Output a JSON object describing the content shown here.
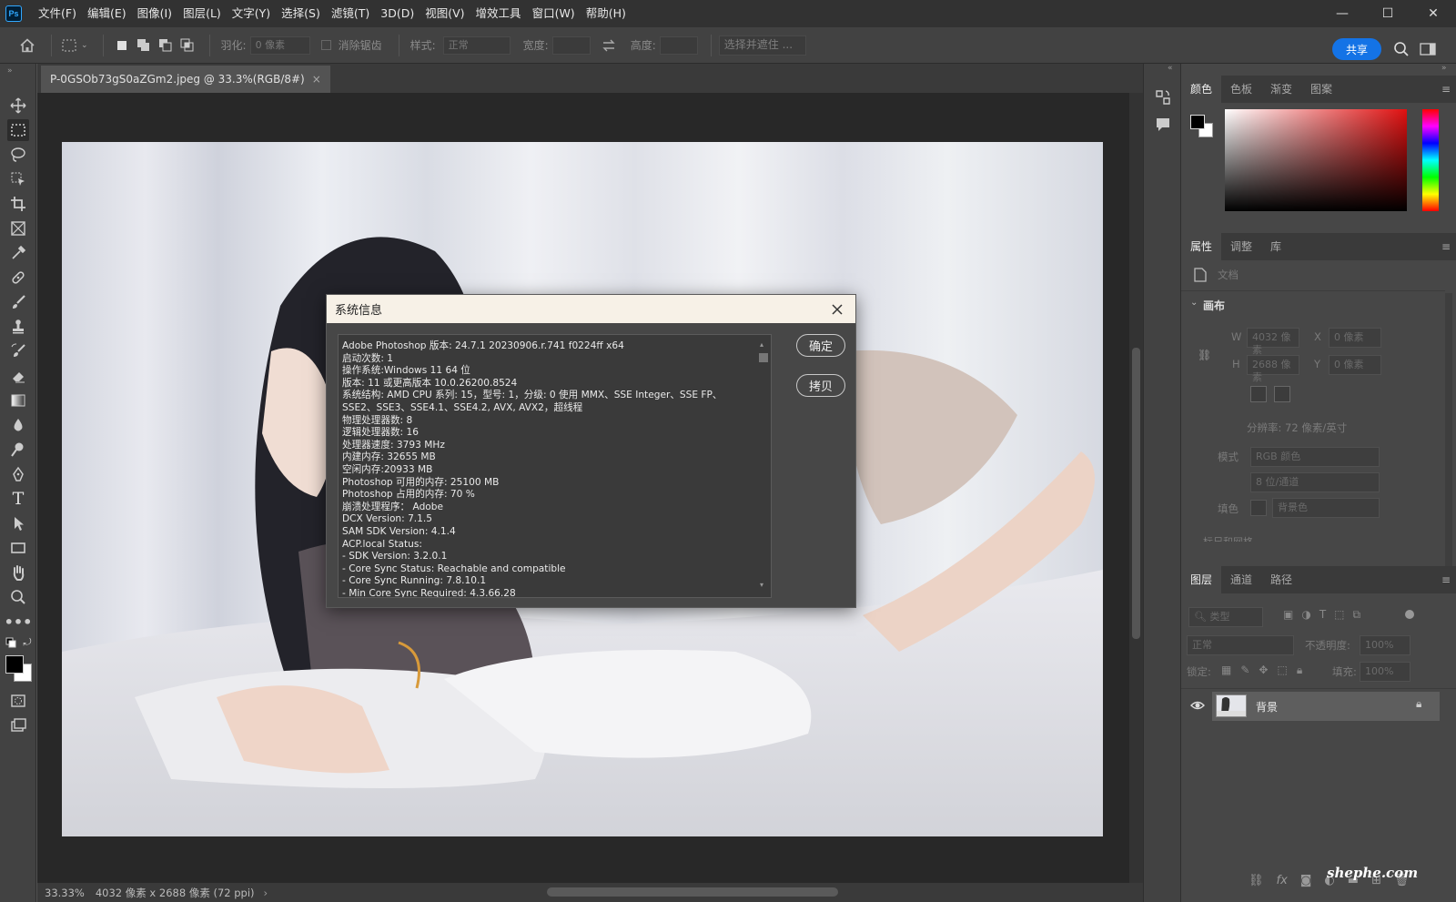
{
  "app": {
    "logo": "Ps",
    "menus": [
      "文件(F)",
      "编辑(E)",
      "图像(I)",
      "图层(L)",
      "文字(Y)",
      "选择(S)",
      "滤镜(T)",
      "3D(D)",
      "视图(V)",
      "增效工具",
      "窗口(W)",
      "帮助(H)"
    ],
    "window_controls": {
      "minimize": "—",
      "maximize": "☐",
      "close": "✕"
    }
  },
  "options_bar": {
    "feather_label": "羽化:",
    "feather_value": "0 像素",
    "antialias_label": "消除锯齿",
    "style_label": "样式:",
    "style_value": "正常",
    "width_label": "宽度:",
    "height_label": "高度:",
    "select_mask": "选择并遮住 ...",
    "share": "共享"
  },
  "document": {
    "tab_title": "P-0GSOb73gS0aZGm2.jpeg @ 33.3%(RGB/8#)",
    "tab_close": "×"
  },
  "status_bar": {
    "zoom": "33.33%",
    "doc_info": "4032 像素 x 2688 像素 (72 ppi)",
    "arrow": "›"
  },
  "dialog": {
    "title": "系统信息",
    "ok": "确定",
    "copy": "拷贝",
    "lines": [
      "Adobe Photoshop 版本: 24.7.1 20230906.r.741 f0224ff  x64",
      "启动次数: 1",
      "操作系统:Windows 11 64 位",
      "版本: 11 或更高版本 10.0.26200.8524",
      "系统结构: AMD CPU 系列: 15，型号: 1，分级: 0 使用 MMX、SSE Integer、SSE FP、",
      "SSE2、SSE3、SSE4.1、SSE4.2, AVX, AVX2，超线程",
      "物理处理器数: 8",
      "逻辑处理器数: 16",
      "处理器速度: 3793 MHz",
      "内建内存: 32655 MB",
      "空闲内存:20933 MB",
      "Photoshop 可用的内存: 25100 MB",
      "Photoshop 占用的内存: 70 %",
      "崩溃处理程序： Adobe",
      "DCX Version: 7.1.5",
      "SAM SDK Version: 4.1.4",
      "ACP.local Status:",
      " - SDK Version: 3.2.0.1",
      " - Core Sync Status: Reachable and compatible",
      " - Core Sync Running: 7.8.10.1",
      " - Min Core Sync Required: 4.3.66.28"
    ]
  },
  "color_panel": {
    "tabs": [
      "颜色",
      "色板",
      "渐变",
      "图案"
    ],
    "menu": "≡"
  },
  "properties_panel": {
    "tabs": [
      "属性",
      "调整",
      "库"
    ],
    "doc_label": "文档",
    "section": "画布",
    "w_label": "W",
    "w_value": "4032 像素",
    "x_label": "X",
    "x_value": "0 像素",
    "h_label": "H",
    "h_value": "2688 像素",
    "y_label": "Y",
    "y_value": "0 像素",
    "resolution": "分辨率: 72 像素/英寸",
    "mode_label": "模式",
    "mode_value": "RGB 颜色",
    "depth_value": "8 位/通道",
    "fill_label": "填色",
    "fill_value": "背景色",
    "next_section": "标尺和网格"
  },
  "layers_panel": {
    "tabs": [
      "图层",
      "通道",
      "路径"
    ],
    "filter_value": "类型",
    "blend_mode": "正常",
    "opacity_label": "不透明度:",
    "opacity_value": "100%",
    "lock_label": "锁定:",
    "fill_label": "填充:",
    "fill_value": "100%",
    "layers": [
      {
        "name": "背景",
        "locked": true,
        "visible": true
      }
    ]
  },
  "watermark": "shephe.com",
  "colors": {
    "accent": "#1473e6",
    "foreground": "#000000",
    "background": "#ffffff"
  }
}
